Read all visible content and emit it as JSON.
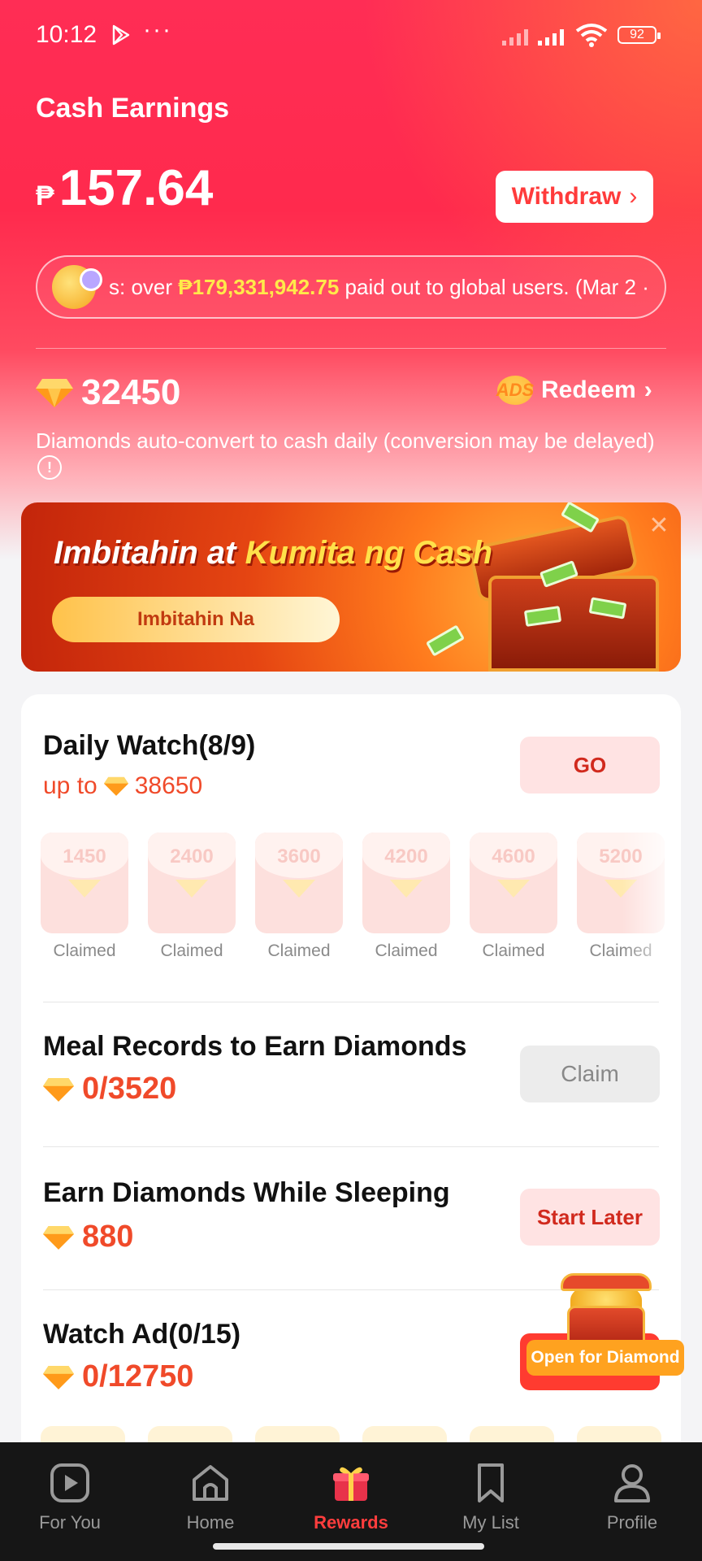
{
  "status_bar": {
    "time": "10:12",
    "dots": "···",
    "battery": "92"
  },
  "cash": {
    "title": "Cash Earnings",
    "currency_symbol": "₱",
    "amount": "157.64",
    "withdraw_label": "Withdraw",
    "ticker_prefix": "s: over ",
    "ticker_highlight": "₱179,331,942.75",
    "ticker_suffix": " paid out to global users. (Mar 2 ·"
  },
  "diamonds": {
    "count": "32450",
    "redeem_badge": "ADS",
    "redeem_label": "Redeem",
    "note": "Diamonds auto-convert to cash daily (conversion may be delayed)",
    "info_icon": "!"
  },
  "banner": {
    "title_part1": "Imbitahin at ",
    "title_part2": "Kumita ng Cash",
    "button_label": "Imbitahin Na",
    "close": "✕"
  },
  "tasks": {
    "daily_watch": {
      "title": "Daily Watch(8/9)",
      "sub_prefix": "up to",
      "sub_value": "38650",
      "button": "GO",
      "envelopes": [
        {
          "value": "1450",
          "label": "Claimed"
        },
        {
          "value": "2400",
          "label": "Claimed"
        },
        {
          "value": "3600",
          "label": "Claimed"
        },
        {
          "value": "4200",
          "label": "Claimed"
        },
        {
          "value": "4600",
          "label": "Claimed"
        },
        {
          "value": "5200",
          "label": "Claimed"
        }
      ]
    },
    "meal_records": {
      "title": "Meal Records to Earn Diamonds",
      "value": "0/3520",
      "button": "Claim"
    },
    "sleeping": {
      "title": "Earn Diamonds While Sleeping",
      "value": "880",
      "button": "Start Later"
    },
    "watch_ad": {
      "title": "Watch Ad(0/15)",
      "value": "0/12750",
      "button": "Open for Diamond"
    }
  },
  "nav": {
    "items": [
      {
        "label": "For You"
      },
      {
        "label": "Home"
      },
      {
        "label": "Rewards"
      },
      {
        "label": "My List"
      },
      {
        "label": "Profile"
      }
    ],
    "active_index": 2
  },
  "colors": {
    "accent": "#ff2d55",
    "highlight": "#ffe94a",
    "task_red": "#f04a2a",
    "nav_active": "#ff3d3d"
  }
}
